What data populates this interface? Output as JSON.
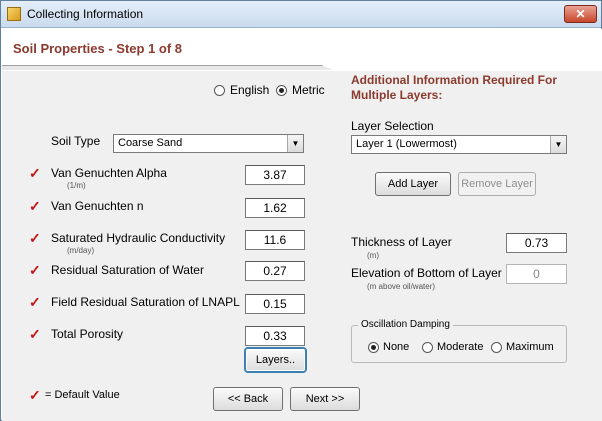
{
  "window": {
    "title": "Collecting Information",
    "close": "✕"
  },
  "header": {
    "step_title": "Soil Properties - Step 1 of 8"
  },
  "units": {
    "english": "English",
    "metric": "Metric",
    "selected": "metric"
  },
  "soil_type": {
    "label": "Soil Type",
    "value": "Coarse Sand"
  },
  "params": [
    {
      "label": "Van Genuchten Alpha",
      "unit": "(1/m)",
      "value": "3.87"
    },
    {
      "label": "Van Genuchten n",
      "unit": "",
      "value": "1.62"
    },
    {
      "label": "Saturated Hydraulic Conductivity",
      "unit": "(m/day)",
      "value": "11.6"
    },
    {
      "label": "Residual Saturation of Water",
      "unit": "",
      "value": "0.27"
    },
    {
      "label": "Field Residual Saturation of LNAPL",
      "unit": "",
      "value": "0.15"
    },
    {
      "label": "Total Porosity",
      "unit": "",
      "value": "0.33"
    }
  ],
  "buttons": {
    "layers": "Layers..",
    "back": "<< Back",
    "next": "Next >>",
    "add_layer": "Add Layer",
    "remove_layer": "Remove Layer"
  },
  "legend": {
    "check": "✓",
    "text": "= Default Value"
  },
  "multi_layer": {
    "heading": "Additional Information Required For Multiple Layers:",
    "selection_label": "Layer Selection",
    "selection_value": "Layer 1 (Lowermost)",
    "thickness_label": "Thickness of Layer",
    "thickness_unit": "(m)",
    "thickness_value": "0.73",
    "elevation_label": "Elevation of Bottom of Layer",
    "elevation_unit": "(m above oil/water)",
    "elevation_value": "0"
  },
  "damping": {
    "title": "Oscillation Damping",
    "options": [
      "None",
      "Moderate",
      "Maximum"
    ],
    "selected": "None"
  },
  "colors": {
    "accent": "#8b3a2e",
    "check": "#c21414"
  },
  "icons": {
    "combo_arrow": "▼"
  }
}
